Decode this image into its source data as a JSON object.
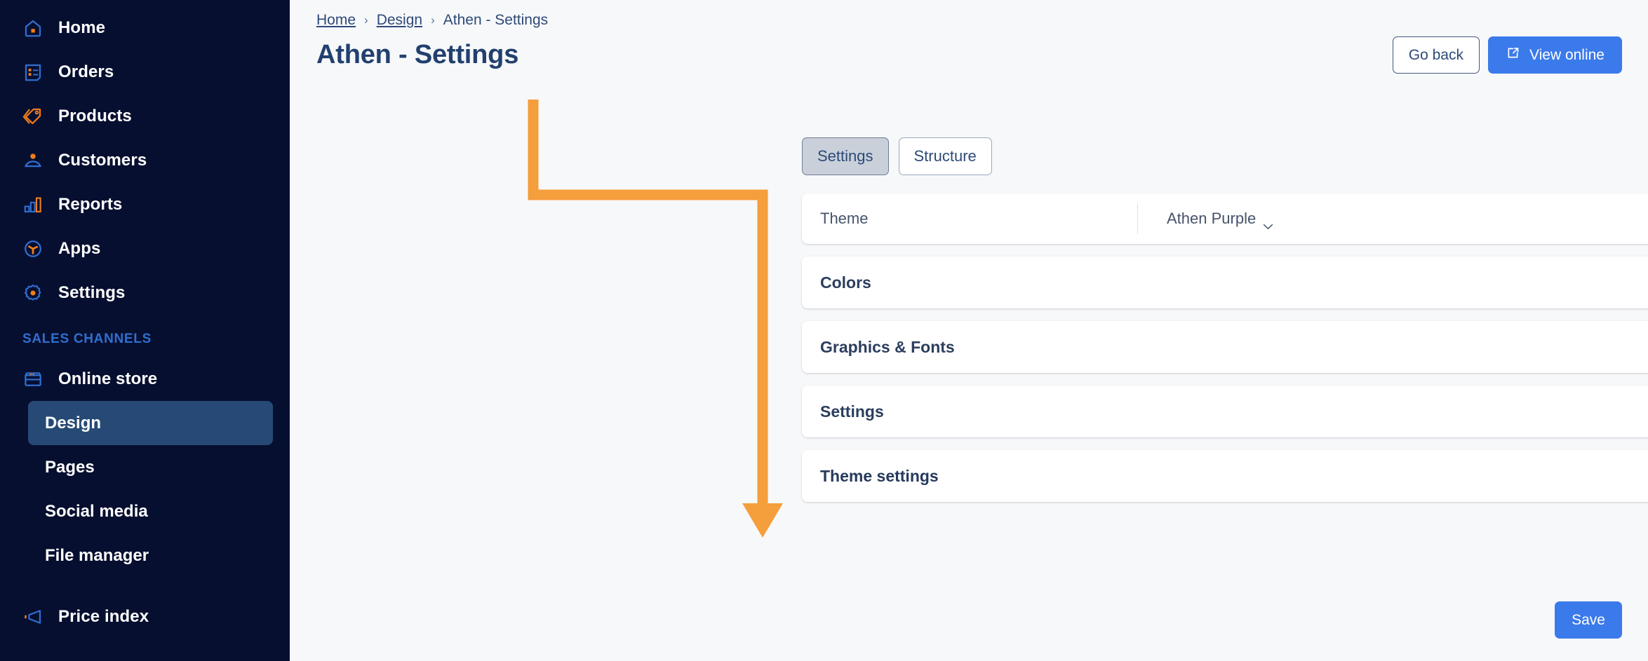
{
  "sidebar": {
    "items": [
      {
        "label": "Home",
        "icon": "home-icon"
      },
      {
        "label": "Orders",
        "icon": "orders-icon"
      },
      {
        "label": "Products",
        "icon": "tag-icon"
      },
      {
        "label": "Customers",
        "icon": "user-icon"
      },
      {
        "label": "Reports",
        "icon": "bar-chart-icon"
      },
      {
        "label": "Apps",
        "icon": "apps-icon"
      },
      {
        "label": "Settings",
        "icon": "gear-icon"
      }
    ],
    "section_label": "SALES CHANNELS",
    "channel": {
      "label": "Online store",
      "icon": "store-icon"
    },
    "sub_items": [
      {
        "label": "Design",
        "active": true
      },
      {
        "label": "Pages",
        "active": false
      },
      {
        "label": "Social media",
        "active": false
      },
      {
        "label": "File manager",
        "active": false
      }
    ],
    "price_index": {
      "label": "Price index",
      "icon": "megaphone-icon"
    },
    "colors": {
      "bg": "#070f30",
      "active_bg": "#264a75",
      "section": "#2f6fd0"
    }
  },
  "breadcrumb": {
    "home": "Home",
    "design": "Design",
    "current": "Athen - Settings",
    "separator": "›"
  },
  "header": {
    "title": "Athen - Settings",
    "go_back_label": "Go back",
    "view_online_label": "View online",
    "view_online_icon": "external-link-icon",
    "primary_color": "#3b7aea"
  },
  "tabs": [
    {
      "label": "Settings",
      "selected": true
    },
    {
      "label": "Structure",
      "selected": false
    }
  ],
  "theme_row": {
    "label": "Theme",
    "value": "Athen Purple",
    "chevron_icon": "chevron-down-icon"
  },
  "accordions": [
    {
      "label": "Colors",
      "bold": false,
      "chevron_icon": "chevron-down-icon"
    },
    {
      "label": "Graphics & Fonts",
      "bold": false,
      "chevron_icon": "chevron-down-icon"
    },
    {
      "label": "Settings",
      "bold": false,
      "chevron_icon": "chevron-down-icon"
    },
    {
      "label": "Theme settings",
      "bold": true,
      "chevron_icon": "chevron-down-icon"
    }
  ],
  "footer": {
    "save_label": "Save"
  },
  "annotation": {
    "arrow_color": "#F59E3C",
    "shape": "elbow-down-right-down-arrow"
  }
}
